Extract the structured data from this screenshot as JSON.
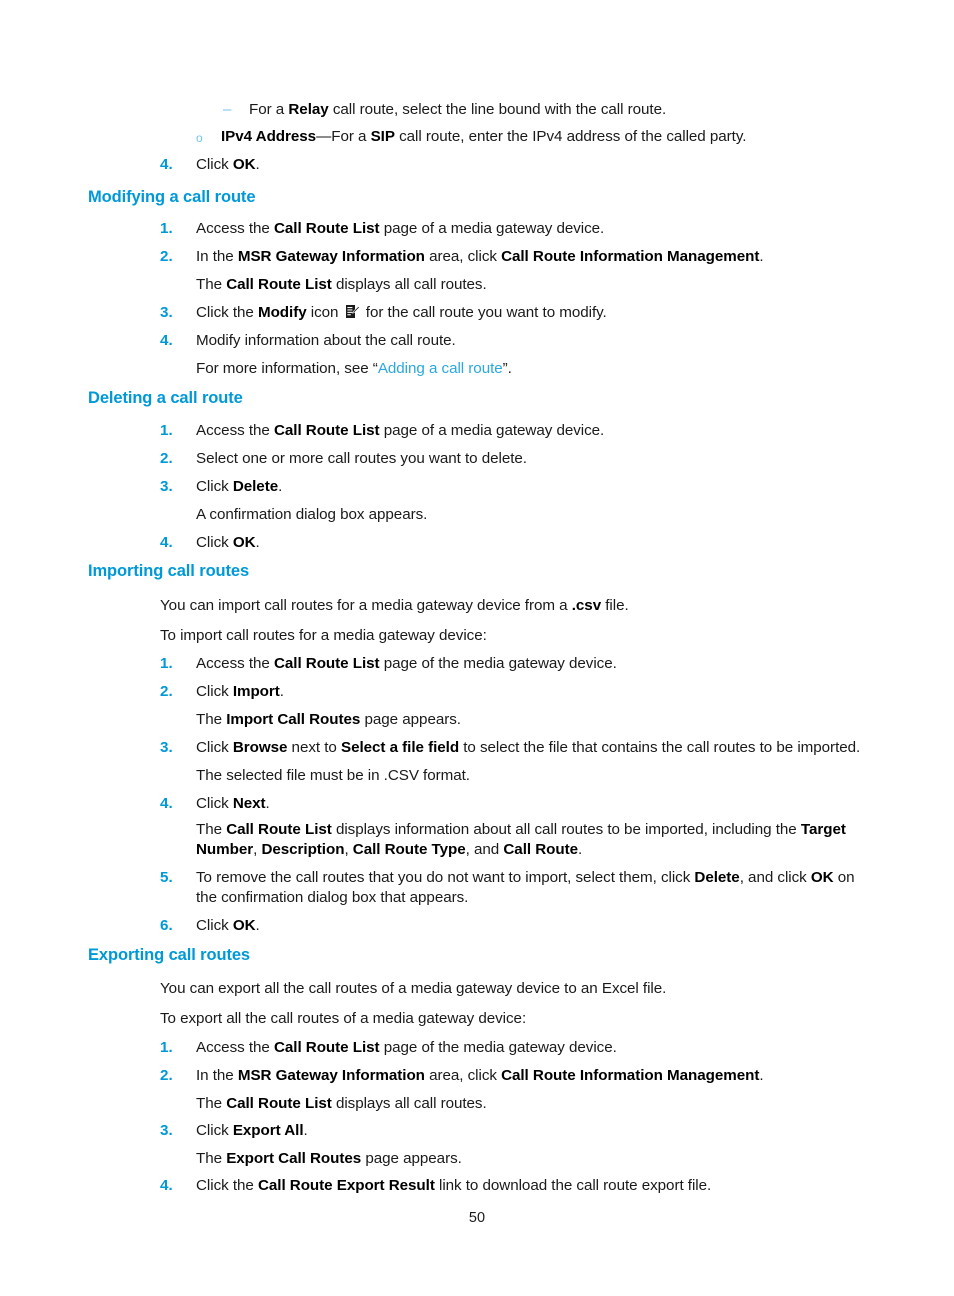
{
  "document": {
    "page_number": "50",
    "accent_color": "#0099d8",
    "marker_color": "#6fc6ea",
    "link_color": "#2aa8e0"
  },
  "top_list": {
    "dash_marker": "–",
    "circle_marker": "o",
    "relay_line": {
      "prefix": "For a ",
      "bold1": "Relay",
      "suffix": " call route, select the line bound with the call route."
    },
    "ipv4_line": {
      "bold1": "IPv4 Address",
      "mid": "—For a ",
      "bold2": "SIP",
      "suffix": " call route, enter the IPv4 address of the called party."
    },
    "step4": {
      "number": "4.",
      "prefix": "Click ",
      "bold1": "OK",
      "suffix": "."
    }
  },
  "sections": [
    {
      "heading": "Modifying a call route",
      "steps": [
        {
          "number": "1.",
          "prefix": "Access the ",
          "bold1": "Call Route List",
          "suffix": " page of a media gateway device."
        },
        {
          "number": "2.",
          "prefix": "In the ",
          "bold1": "MSR Gateway Information",
          "mid": " area, click ",
          "bold2": "Call Route Information Management",
          "suffix": ".",
          "sub": {
            "prefix": "The ",
            "bold1": "Call Route List",
            "suffix": " displays all call routes."
          }
        },
        {
          "number": "3.",
          "prefix": "Click the ",
          "bold1": "Modify",
          "mid": " icon ",
          "icon": "modify-icon",
          "suffix": " for the call route you want to modify."
        },
        {
          "number": "4.",
          "prefix": "Modify information about the call route.",
          "sub": {
            "prefix": "For more information, see “",
            "link": "Adding a call route",
            "suffix": "”."
          }
        }
      ]
    },
    {
      "heading": "Deleting a call route",
      "steps": [
        {
          "number": "1.",
          "prefix": "Access the ",
          "bold1": "Call Route List",
          "suffix": " page of a media gateway device."
        },
        {
          "number": "2.",
          "prefix": "Select one or more call routes you want to delete."
        },
        {
          "number": "3.",
          "prefix": "Click ",
          "bold1": "Delete",
          "suffix": ".",
          "sub": {
            "prefix": "A confirmation dialog box appears."
          }
        },
        {
          "number": "4.",
          "prefix": "Click ",
          "bold1": "OK",
          "suffix": "."
        }
      ]
    },
    {
      "heading": "Importing call routes",
      "intro1": {
        "prefix": "You can import call routes for a media gateway device from a ",
        "bold1": ".csv",
        "suffix": " file."
      },
      "intro2": {
        "prefix": "To import call routes for a media gateway device:"
      },
      "steps": [
        {
          "number": "1.",
          "prefix": "Access the ",
          "bold1": "Call Route List",
          "suffix": " page of the media gateway device."
        },
        {
          "number": "2.",
          "prefix": "Click ",
          "bold1": "Import",
          "suffix": ".",
          "sub": {
            "prefix": "The ",
            "bold1": "Import Call Routes",
            "suffix": " page appears."
          }
        },
        {
          "number": "3.",
          "prefix": "Click ",
          "bold1": "Browse",
          "mid": " next to ",
          "bold2": "Select a file field",
          "suffix": " to select the file that contains the call routes to be imported.",
          "sub": {
            "prefix": "The selected file must be in .CSV format."
          }
        },
        {
          "number": "4.",
          "prefix": "Click ",
          "bold1": "Next",
          "suffix": ".",
          "sub_rich": {
            "p1": "The ",
            "b1": "Call Route List",
            "p2": " displays information about all call routes to be imported, including the ",
            "b2": "Target Number",
            "p3": ", ",
            "b3": "Description",
            "p4": ", ",
            "b4": "Call Route Type",
            "p5": ", and ",
            "b5": "Call Route",
            "p6": "."
          }
        },
        {
          "number": "5.",
          "rich": {
            "p1": "To remove the call routes that you do not want to import, select them, click ",
            "b1": "Delete",
            "p2": ", and click ",
            "b2": "OK",
            "p3": " on the confirmation dialog box that appears."
          }
        },
        {
          "number": "6.",
          "prefix": "Click ",
          "bold1": "OK",
          "suffix": "."
        }
      ]
    },
    {
      "heading": "Exporting call routes",
      "intro1": {
        "prefix": "You can export all the call routes of a media gateway device to an Excel file."
      },
      "intro2": {
        "prefix": "To export all the call routes of a media gateway device:"
      },
      "steps": [
        {
          "number": "1.",
          "prefix": "Access the ",
          "bold1": "Call Route List",
          "suffix": " page of the media gateway device."
        },
        {
          "number": "2.",
          "prefix": "In the ",
          "bold1": "MSR Gateway Information",
          "mid": " area, click ",
          "bold2": "Call Route Information Management",
          "suffix": ".",
          "sub": {
            "prefix": "The ",
            "bold1": "Call Route List",
            "suffix": " displays all call routes."
          }
        },
        {
          "number": "3.",
          "prefix": "Click ",
          "bold1": "Export All",
          "suffix": ".",
          "sub": {
            "prefix": "The ",
            "bold1": "Export Call Routes",
            "suffix": " page appears."
          }
        },
        {
          "number": "4.",
          "prefix": "Click the ",
          "bold1": "Call Route Export Result",
          "suffix": " link to download the call route export file."
        }
      ]
    }
  ]
}
